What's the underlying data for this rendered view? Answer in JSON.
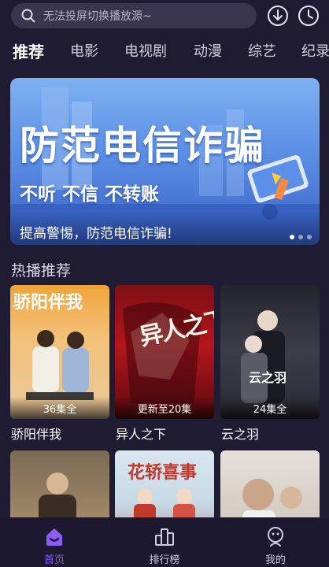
{
  "search": {
    "placeholder": "无法投屏切换播放源~"
  },
  "header_icons": [
    "download-icon",
    "history-icon"
  ],
  "tabs": [
    {
      "label": "推荐",
      "active": true
    },
    {
      "label": "电影",
      "active": false
    },
    {
      "label": "电视剧",
      "active": false
    },
    {
      "label": "动漫",
      "active": false
    },
    {
      "label": "综艺",
      "active": false
    },
    {
      "label": "纪录",
      "active": false
    }
  ],
  "banner": {
    "headline": "防范电信诈骗",
    "subline": "不听 不信 不转账",
    "caption": "提高警惕，防范电信诈骗!",
    "pages": 3,
    "active_page": 1
  },
  "section": {
    "title": "热播推荐"
  },
  "posters": [
    {
      "title": "骄阳伴我",
      "badge": "36集全",
      "art_text": "骄阳伴我"
    },
    {
      "title": "异人之下",
      "badge": "更新至20集",
      "art_text": "异人之下"
    },
    {
      "title": "云之羽",
      "badge": "24集全",
      "art_text": "云之羽"
    },
    {
      "title": "",
      "badge": "",
      "art_text": ""
    },
    {
      "title": "",
      "badge": "",
      "art_text": "花轿喜事"
    },
    {
      "title": "",
      "badge": "",
      "art_text": ""
    }
  ],
  "bottom_nav": [
    {
      "label": "首页",
      "icon": "home-icon",
      "active": true
    },
    {
      "label": "排行榜",
      "icon": "ranking-icon",
      "active": false
    },
    {
      "label": "我的",
      "icon": "profile-icon",
      "active": false
    }
  ],
  "colors": {
    "background": "#1f1b33",
    "search_bg": "#3a3650",
    "accent": "#8b5cf6",
    "nav_inactive": "#cfcbe0"
  }
}
